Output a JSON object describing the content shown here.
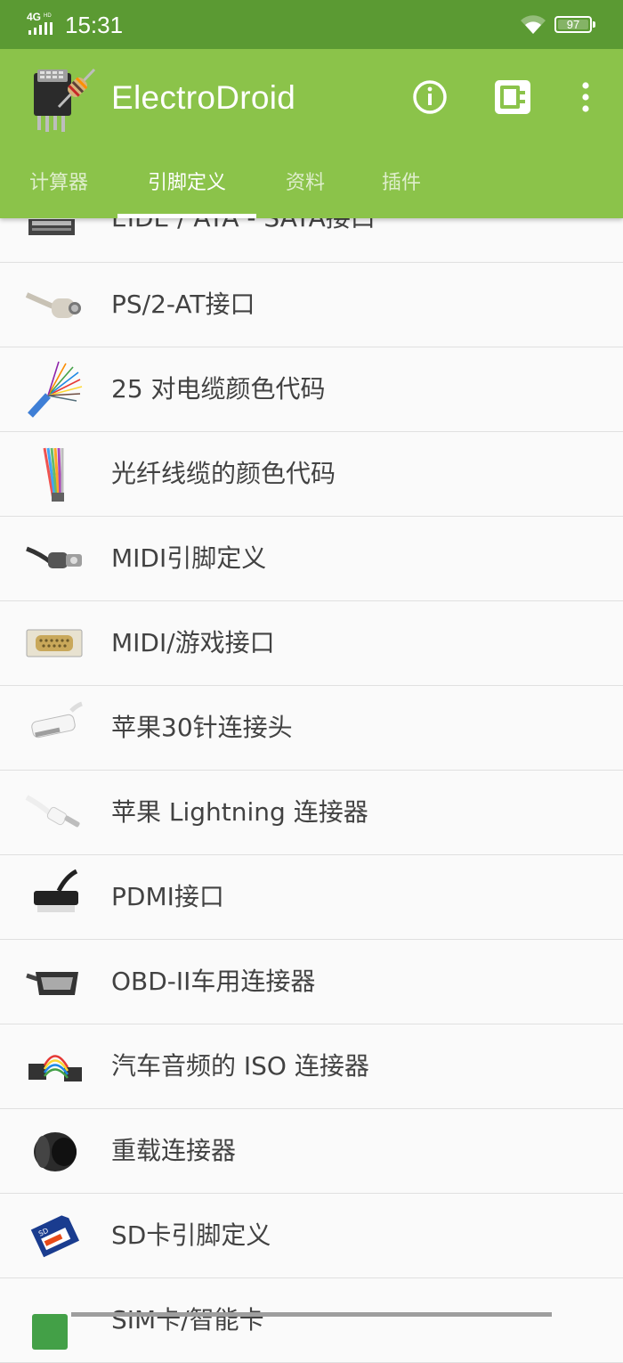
{
  "status_bar": {
    "network": "4G",
    "time": "15:31",
    "battery": "97"
  },
  "app_bar": {
    "title": "ElectroDroid",
    "actions": [
      {
        "name": "info-icon"
      },
      {
        "name": "plugin-icon"
      },
      {
        "name": "more-vert-icon"
      }
    ]
  },
  "tabs": [
    {
      "label": "计算器",
      "active": false
    },
    {
      "label": "引脚定义",
      "active": true
    },
    {
      "label": "资料",
      "active": false
    },
    {
      "label": "插件",
      "active": false
    }
  ],
  "list": {
    "items": [
      {
        "label": "EIDE / ATA - SATA接口",
        "icon": "ribbon-cable-icon"
      },
      {
        "label": "PS/2-AT接口",
        "icon": "ps2-connector-icon"
      },
      {
        "label": "25 对电缆颜色代码",
        "icon": "multi-pair-cable-icon"
      },
      {
        "label": "光纤线缆的颜色代码",
        "icon": "fiber-cable-icon"
      },
      {
        "label": "MIDI引脚定义",
        "icon": "midi-cable-icon"
      },
      {
        "label": "MIDI/游戏接口",
        "icon": "db15-connector-icon"
      },
      {
        "label": "苹果30针连接头",
        "icon": "apple-30pin-icon"
      },
      {
        "label": "苹果 Lightning 连接器",
        "icon": "lightning-cable-icon"
      },
      {
        "label": "PDMI接口",
        "icon": "pdmi-cable-icon"
      },
      {
        "label": "OBD-II车用连接器",
        "icon": "obd2-connector-icon"
      },
      {
        "label": "汽车音频的 ISO 连接器",
        "icon": "iso-car-audio-icon"
      },
      {
        "label": "重载连接器",
        "icon": "heavy-duty-connector-icon"
      },
      {
        "label": "SD卡引脚定义",
        "icon": "sd-card-icon"
      },
      {
        "label": "SIM卡/智能卡",
        "icon": "sim-card-icon"
      }
    ]
  },
  "colors": {
    "status_bar": "#5b9a33",
    "app_bar": "#8bc34a",
    "list_text": "#424242",
    "divider": "#e0e0e0"
  }
}
